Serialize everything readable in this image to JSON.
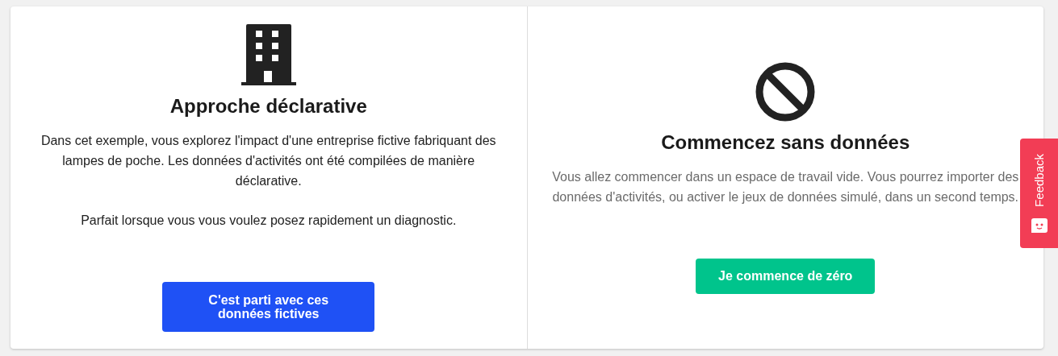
{
  "options": [
    {
      "kind": "building",
      "title": "Approche déclarative",
      "muted": false,
      "paragraphs": [
        "Dans cet exemple, vous explorez l'impact d'une entreprise fictive fabriquant des lampes de poche. Les données d'activités ont été compilées de manière déclarative.",
        "Parfait lorsque vous vous voulez posez rapidement un diagnostic."
      ],
      "button": {
        "label": "C'est parti avec ces données fictives",
        "color": "#1f51f5"
      }
    },
    {
      "kind": "ban",
      "title": "Commencez sans données",
      "muted": true,
      "paragraphs": [
        "Vous allez commencer dans un espace de travail vide. Vous pourrez importer des données d'activités, ou activer le jeux de données simulé, dans un second temps."
      ],
      "button": {
        "label": "Je commence de zéro",
        "color": "#00c48c"
      }
    }
  ],
  "feedback_tab": {
    "label": "Feedback"
  }
}
